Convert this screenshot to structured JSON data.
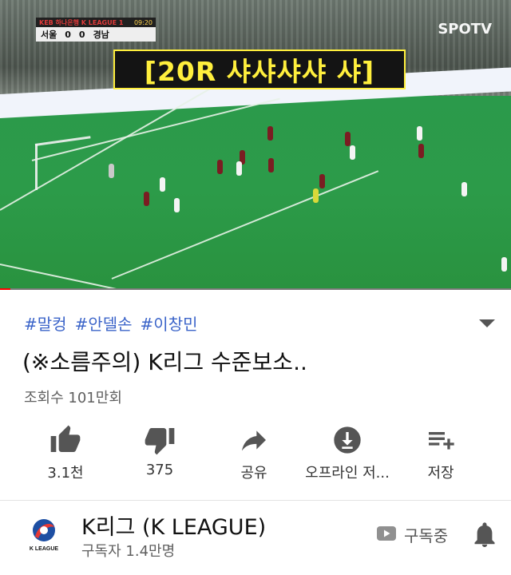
{
  "video": {
    "caption": "[20R 샤샤샤샤 샤]",
    "broadcaster": "SPOTV",
    "scoreboard": {
      "league": "KEB 하나은행 K LEAGUE 1",
      "time": "09:20",
      "home_team": "서울",
      "home_score": "0",
      "away_score": "0",
      "away_team": "경남"
    },
    "progress_fraction": 0.02
  },
  "details": {
    "hashtags": [
      "#말컹",
      "#안델손",
      "#이창민"
    ],
    "title": "(※소름주의) K리그 수준보소..",
    "views": "조회수 101만회"
  },
  "actions": {
    "like_count": "3.1천",
    "dislike_count": "375",
    "share_label": "공유",
    "offline_label": "오프라인 저...",
    "save_label": "저장"
  },
  "channel": {
    "name": "K리그 (K LEAGUE)",
    "subscribers": "구독자 1.4만명",
    "subscribed_label": "구독중",
    "logo_text": "K LEAGUE"
  },
  "colors": {
    "hashtag": "#3b64c9",
    "progress": "#ff0000",
    "caption_text": "#ffef3d"
  }
}
